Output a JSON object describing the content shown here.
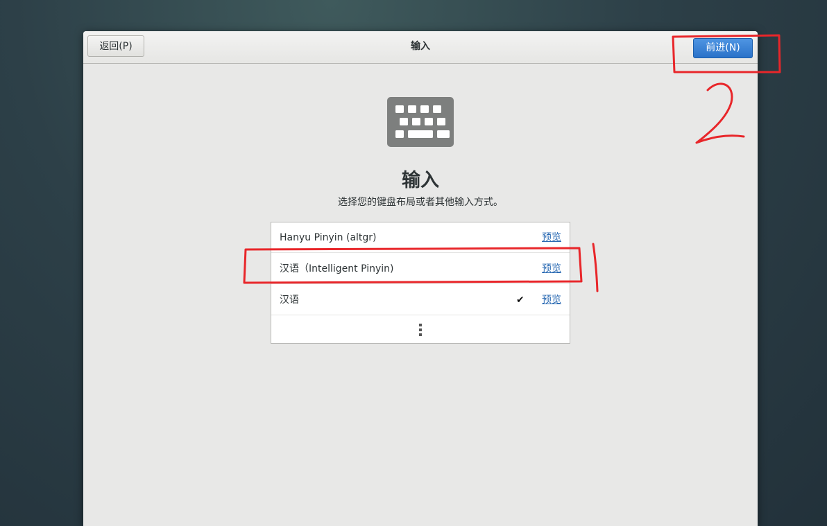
{
  "header": {
    "back_label": "返回(P)",
    "title": "输入",
    "next_label": "前进(N)"
  },
  "main": {
    "icon": "keyboard-icon",
    "title": "输入",
    "subtitle": "选择您的键盘布局或者其他输入方式。"
  },
  "input_sources": [
    {
      "name": "Hanyu Pinyin (altgr)",
      "preview": "预览",
      "selected": false
    },
    {
      "name": "汉语（Intelligent Pinyin)",
      "preview": "预览",
      "selected": false
    },
    {
      "name": "汉语",
      "preview": "预览",
      "selected": true
    }
  ],
  "more_icon": "more-vertical-icon",
  "checkmark": "✔",
  "annotations": {
    "color": "#e8262a",
    "label_1": "1",
    "label_2": "2"
  },
  "colors": {
    "accent": "#2a72c9",
    "link": "#2a6ab3"
  }
}
